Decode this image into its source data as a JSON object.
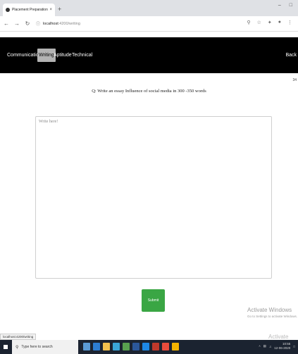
{
  "browser": {
    "tab_title": "Placement Preparation",
    "tab_close": "×",
    "new_tab": "+",
    "window_controls": [
      "–",
      "□"
    ],
    "url_host": "localhost",
    "url_path": ":4200/writing",
    "nav": {
      "back": "←",
      "forward": "→",
      "reload": "↻",
      "info": "ⓘ"
    }
  },
  "navbar": {
    "items": [
      {
        "label": "Communication",
        "active": false
      },
      {
        "label": "Writing",
        "active": true
      },
      {
        "label": "Aptitude",
        "active": false
      },
      {
        "label": "Technical",
        "active": false
      }
    ],
    "back_label": "Back"
  },
  "timer": "34",
  "question": "Q: Write an essay Influence of social media in 300 -350 words",
  "essay": {
    "placeholder": "Write here!",
    "value": ""
  },
  "submit_label": "Submit",
  "watermark": {
    "title": "Activate Windows",
    "subtitle": "Go to Settings to activate Windows.",
    "bottom_partial": "Activate Wind"
  },
  "status_url": "localhost:4200/writing",
  "taskbar": {
    "search_placeholder": "Type here to search",
    "clock_time": "10:55",
    "clock_date": "12-06-2020",
    "app_colors": [
      "#5b9bd5",
      "#2d7dd2",
      "#f2c14e",
      "#3aa6d8",
      "#59a14f",
      "#2b579a",
      "#1e88e5",
      "#c0392b",
      "#e74c3c",
      "#f4b400"
    ]
  }
}
